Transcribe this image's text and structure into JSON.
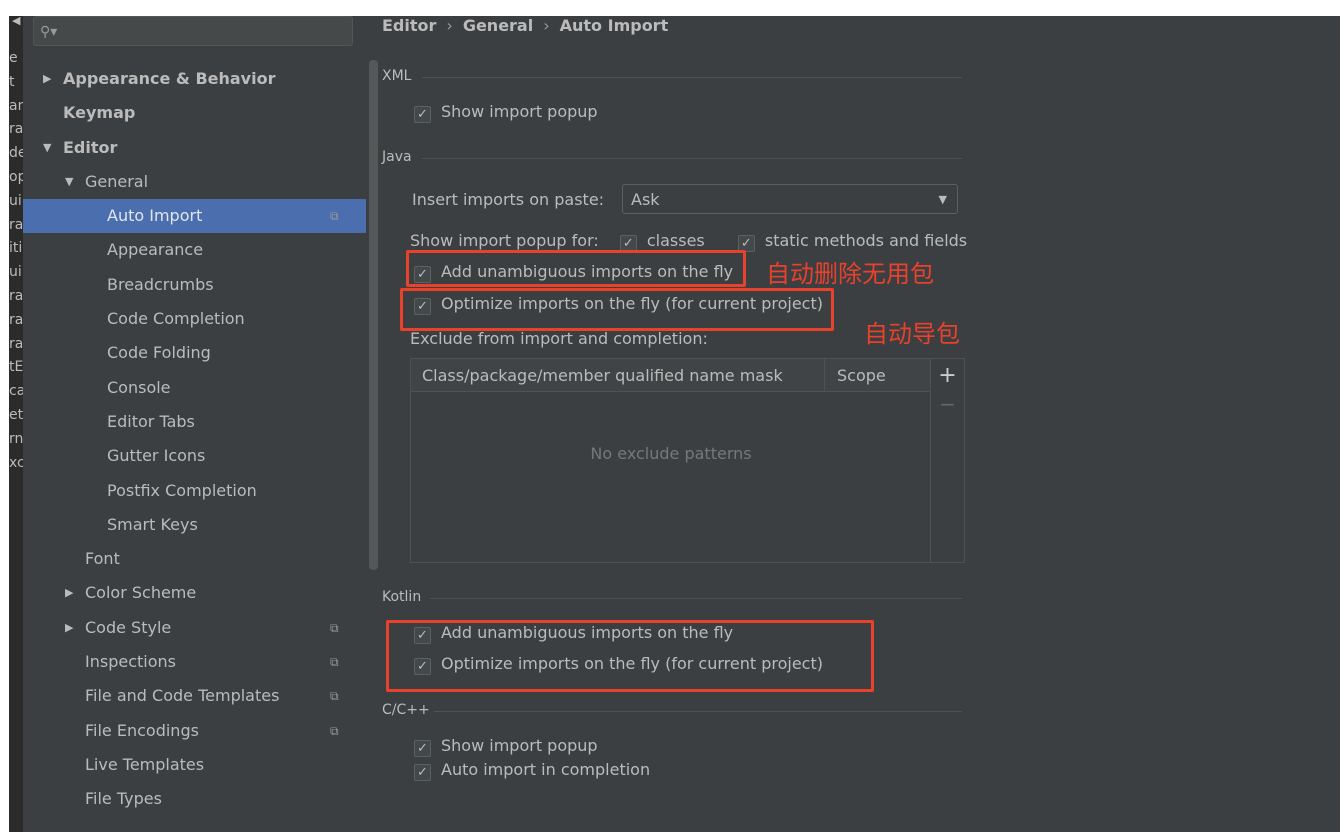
{
  "strip": {
    "back_icon": "arrow-left-icon",
    "fragments": [
      "e",
      "t",
      "an",
      "ra",
      "de",
      "op",
      "ui",
      "ra",
      "iti",
      "ui",
      "ra",
      "ra",
      "ra",
      "tE",
      "ca",
      "ett",
      "rn",
      "xcl"
    ]
  },
  "search": {
    "icon": "search-icon",
    "value": ""
  },
  "tree": [
    {
      "label": "Appearance & Behavior",
      "level": 0,
      "bold": true,
      "arrow": "right"
    },
    {
      "label": "Keymap",
      "level": 0,
      "bold": true
    },
    {
      "label": "Editor",
      "level": 0,
      "bold": true,
      "arrow": "down"
    },
    {
      "label": "General",
      "level": 1,
      "arrow": "down"
    },
    {
      "label": "Auto Import",
      "level": 2,
      "selected": true,
      "copy": true
    },
    {
      "label": "Appearance",
      "level": 2
    },
    {
      "label": "Breadcrumbs",
      "level": 2
    },
    {
      "label": "Code Completion",
      "level": 2
    },
    {
      "label": "Code Folding",
      "level": 2
    },
    {
      "label": "Console",
      "level": 2
    },
    {
      "label": "Editor Tabs",
      "level": 2
    },
    {
      "label": "Gutter Icons",
      "level": 2
    },
    {
      "label": "Postfix Completion",
      "level": 2
    },
    {
      "label": "Smart Keys",
      "level": 2
    },
    {
      "label": "Font",
      "level": 1
    },
    {
      "label": "Color Scheme",
      "level": 1,
      "arrow": "right"
    },
    {
      "label": "Code Style",
      "level": 1,
      "arrow": "right",
      "copy": true
    },
    {
      "label": "Inspections",
      "level": 1,
      "copy": true
    },
    {
      "label": "File and Code Templates",
      "level": 1,
      "copy": true
    },
    {
      "label": "File Encodings",
      "level": 1,
      "copy": true
    },
    {
      "label": "Live Templates",
      "level": 1
    },
    {
      "label": "File Types",
      "level": 1
    }
  ],
  "breadcrumb": [
    "Editor",
    "General",
    "Auto Import"
  ],
  "xml": {
    "title": "XML",
    "show_popup": "Show import popup"
  },
  "java": {
    "title": "Java",
    "insert_label": "Insert imports on paste:",
    "insert_value": "Ask",
    "popup_for": "Show import popup for:",
    "classes": "classes",
    "static": "static methods and fields",
    "add_unambiguous": "Add unambiguous imports on the fly",
    "optimize": "Optimize imports on the fly (for current project)",
    "exclude_label": "Exclude from import and completion:",
    "col_mask": "Class/package/member qualified name mask",
    "col_scope": "Scope",
    "empty": "No exclude patterns",
    "add": "+",
    "remove": "−"
  },
  "kotlin": {
    "title": "Kotlin",
    "add_unambiguous": "Add unambiguous imports on the fly",
    "optimize": "Optimize imports on the fly (for current project)"
  },
  "cpp": {
    "title": "C/C++",
    "show_popup": "Show import popup",
    "auto_import": "Auto import in completion"
  },
  "annotations": {
    "note1": "自动删除无用包",
    "note2": "自动导包",
    "color": "#e8412c"
  }
}
